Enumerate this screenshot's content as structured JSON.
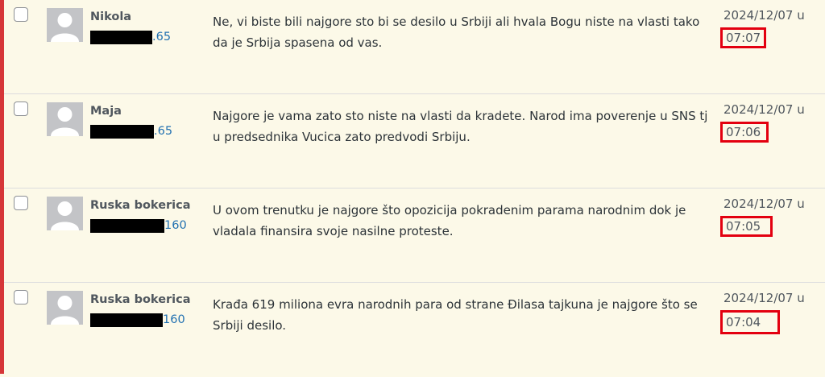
{
  "comments": [
    {
      "author": "Nikola",
      "ip_suffix": ".65",
      "text": "Ne, vi biste bili najgore sto bi se desilo u Srbiji ali hvala Bogu niste na vlasti tako da je Srbija spasena od vas.",
      "date": "2024/12/07 u",
      "time": "07:07"
    },
    {
      "author": "Maja",
      "ip_suffix": ".65",
      "text": "Najgore je vama zato sto niste na vlasti da kradete. Narod ima poverenje u SNS tj u predsednika Vucica zato predvodi Srbiju.",
      "date": "2024/12/07 u",
      "time": "07:06"
    },
    {
      "author": "Ruska bokerica",
      "ip_suffix": "160",
      "text": "U ovom trenutku je najgore što opozicija pokradenim parama narodnim dok je vladala finansira svoje nasilne proteste.",
      "date": "2024/12/07 u",
      "time": "07:05"
    },
    {
      "author": "Ruska bokerica",
      "ip_suffix": "160",
      "text": "Krađa 619 miliona evra narodnih para od strane Đilasa tajkuna je najgore što se Srbiji desilo.",
      "date": "2024/12/07 u",
      "time": "07:04"
    }
  ]
}
